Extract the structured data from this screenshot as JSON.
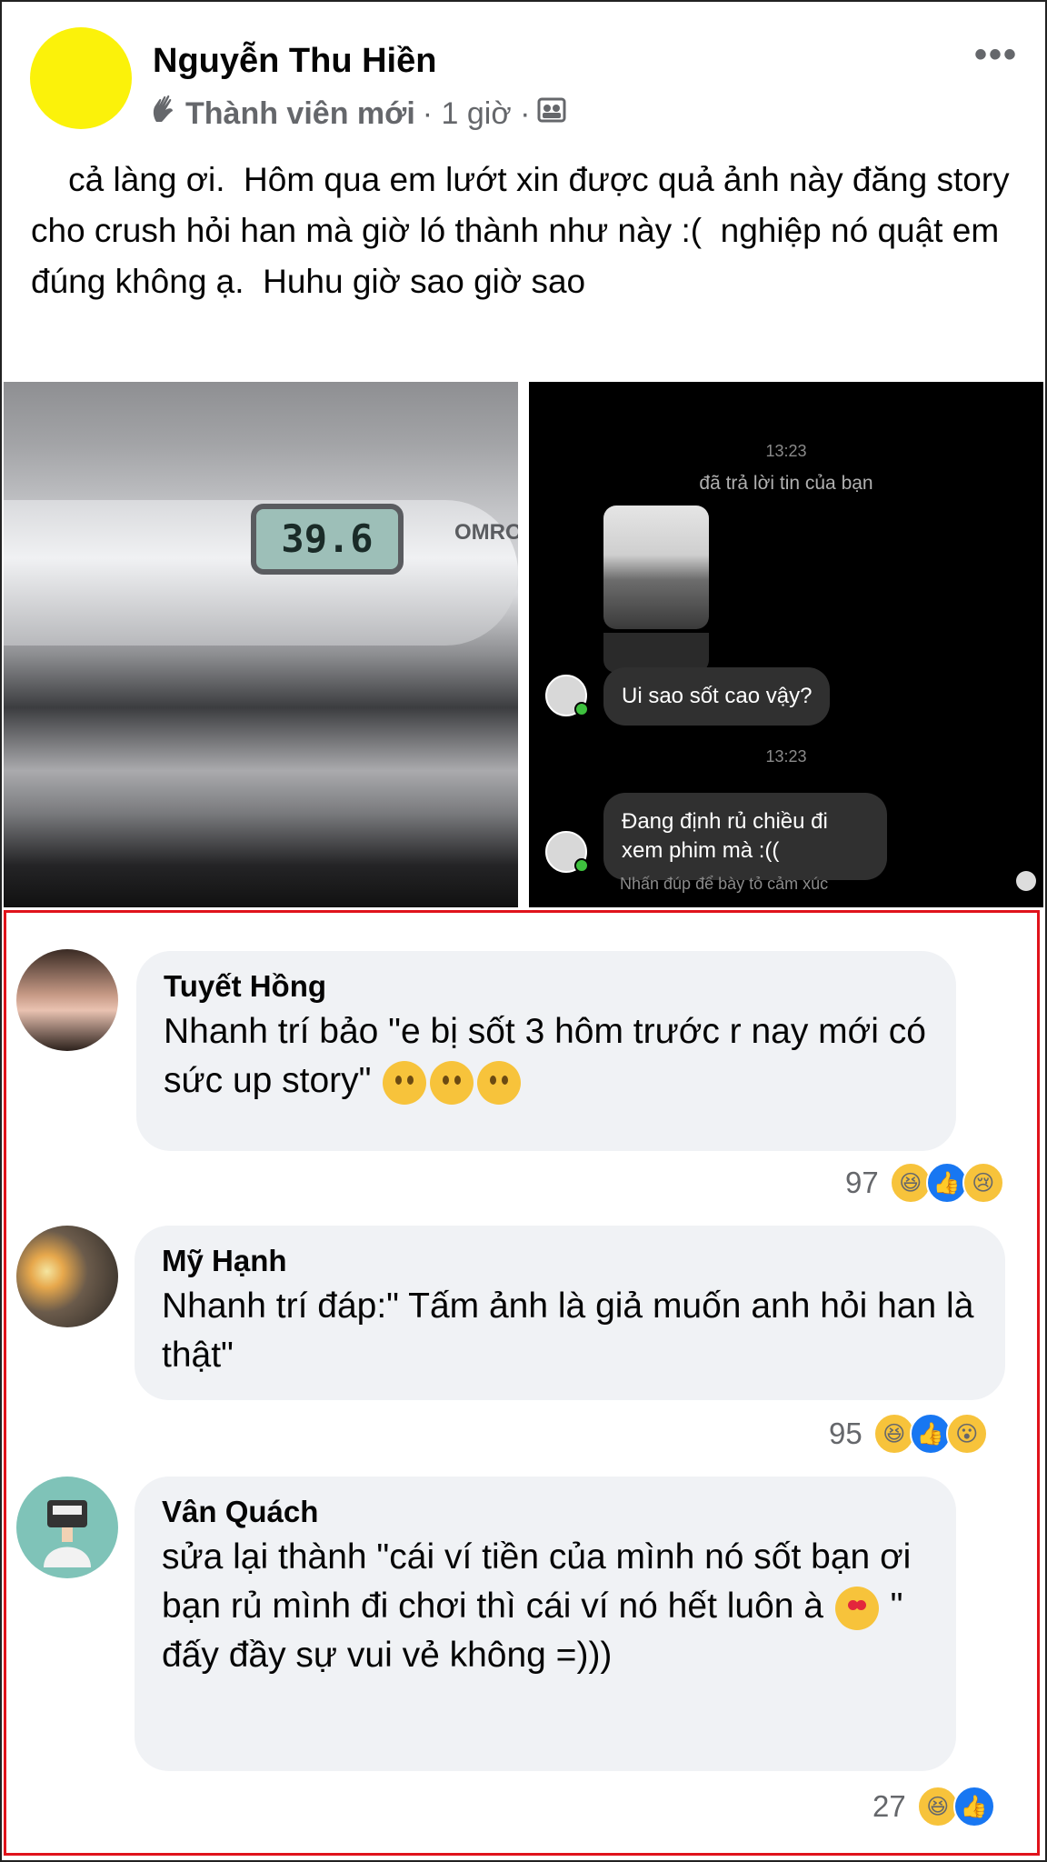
{
  "post": {
    "author": "Nguyễn Thu Hiền",
    "badge": "Thành viên mới",
    "time": "· 1 giờ ·",
    "more": "•••",
    "text": "    cả làng ơi.  Hôm qua em lướt xin được quả ảnh này đăng story cho crush hỏi han mà giờ ló thành như này :(  nghiệp nó quật em đúng không ạ.  Huhu giờ sao giờ sao"
  },
  "images": {
    "thermometer": {
      "reading": "39.6",
      "brand": "OMRO"
    },
    "chat": {
      "time1": "13:23",
      "replied_note": "đã trả lời tin của bạn",
      "message1": "Ui sao sốt cao vậy?",
      "time2": "13:23",
      "message2": "Đang định rủ chiều đi xem phim mà :((",
      "hint": "Nhấn đúp để bày tỏ cảm xúc"
    }
  },
  "comments": [
    {
      "name": "Tuyết Hồng",
      "text": "Nhanh trí bảo \"e bị sốt 3 hôm trước r nay mới có sức up story\"",
      "reactions": "97"
    },
    {
      "name": "Mỹ Hạnh",
      "text": "Nhanh trí đáp:\" Tấm ảnh là giả muốn anh hỏi han là thật\"",
      "reactions": "95"
    },
    {
      "name": "Vân Quách",
      "text_a": "sửa lại thành \"cái ví tiền của mình nó sốt bạn ơi bạn rủ mình đi chơi thì cái ví nó hết luôn à",
      "text_b": " \"",
      "text_c": "đấy đầy sự vui vẻ không =)))",
      "reactions": "27"
    }
  ],
  "colors": {
    "accent_red": "#e0131b",
    "bubble_bg": "#f0f2f5",
    "like_blue": "#1877f2",
    "haha_yellow": "#f7c33b"
  }
}
